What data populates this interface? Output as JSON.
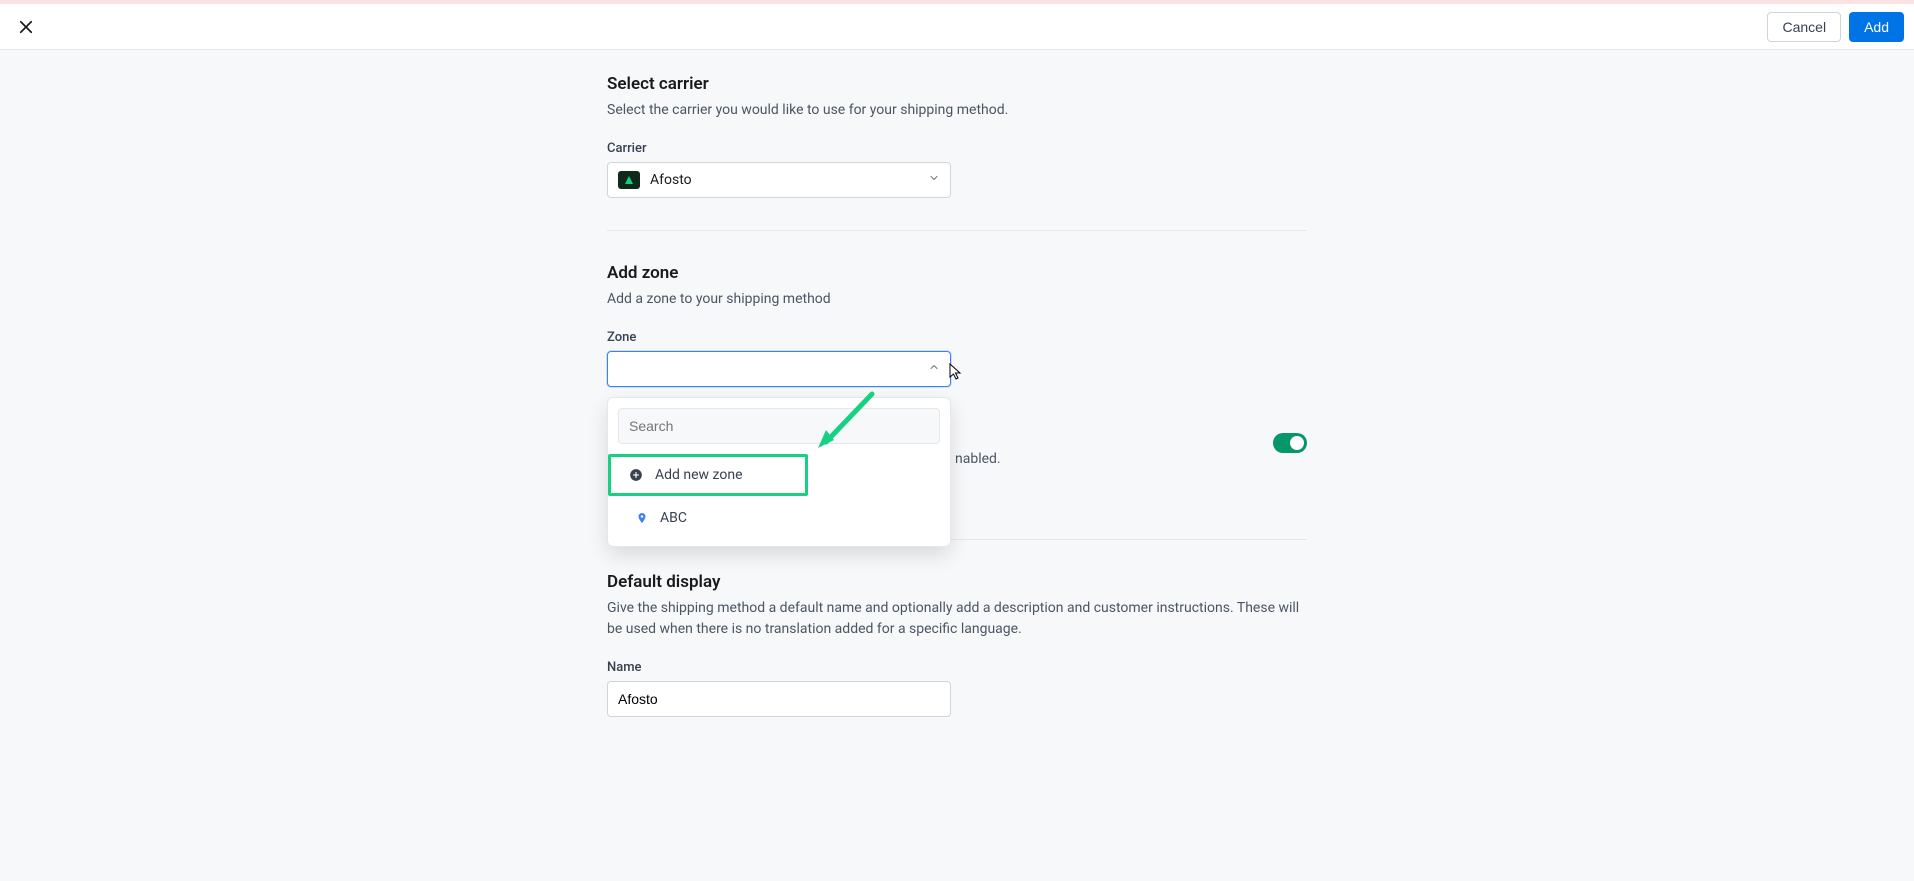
{
  "header": {
    "cancel_label": "Cancel",
    "add_label": "Add"
  },
  "carrier_section": {
    "title": "Select carrier",
    "description": "Select the carrier you would like to use for your shipping method.",
    "field_label": "Carrier",
    "selected_value": "Afosto"
  },
  "zone_section": {
    "title": "Add zone",
    "description": "Add a zone to your shipping method",
    "field_label": "Zone",
    "search_placeholder": "Search",
    "add_new_label": "Add new zone",
    "options": [
      {
        "label": "ABC"
      }
    ]
  },
  "enabled_section": {
    "visible_text_fragment": "nabled.",
    "toggle_on": true
  },
  "display_section": {
    "title": "Default display",
    "description": "Give the shipping method a default name and optionally add a description and customer instructions. These will be used when there is no translation added for a specific language.",
    "name_label": "Name",
    "name_value": "Afosto"
  }
}
